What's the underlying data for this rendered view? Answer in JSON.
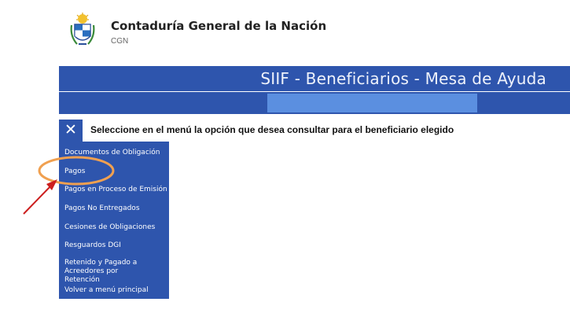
{
  "header": {
    "org_name": "Contaduría General de la Nación",
    "org_abbr": "CGN"
  },
  "banner": {
    "title": "SIIF - Beneficiarios - Mesa de Ayuda"
  },
  "menu": {
    "close_symbol": "✕",
    "instruction": "Seleccione en el menú la opción que desea consultar para el beneficiario elegido",
    "items": [
      {
        "label": "Documentos de Obligación"
      },
      {
        "label": "Pagos"
      },
      {
        "label": "Pagos en Proceso de Emisión"
      },
      {
        "label": "Pagos No Entregados"
      },
      {
        "label": "Cesiones de Obligaciones"
      },
      {
        "label": "Resguardos DGI"
      },
      {
        "label": "Retenido y Pagado a Acreedores por Retención"
      },
      {
        "label": "Volver a menú principal"
      }
    ]
  },
  "colors": {
    "brand_blue": "#2e55ad",
    "subbar_highlight": "#5b8fe0",
    "annotation_circle": "#f0a050",
    "annotation_arrow": "#cc1f1f"
  },
  "icons": {
    "seal": "coat-of-arms-icon",
    "close": "close-icon",
    "arrow": "red-arrow-annotation"
  }
}
